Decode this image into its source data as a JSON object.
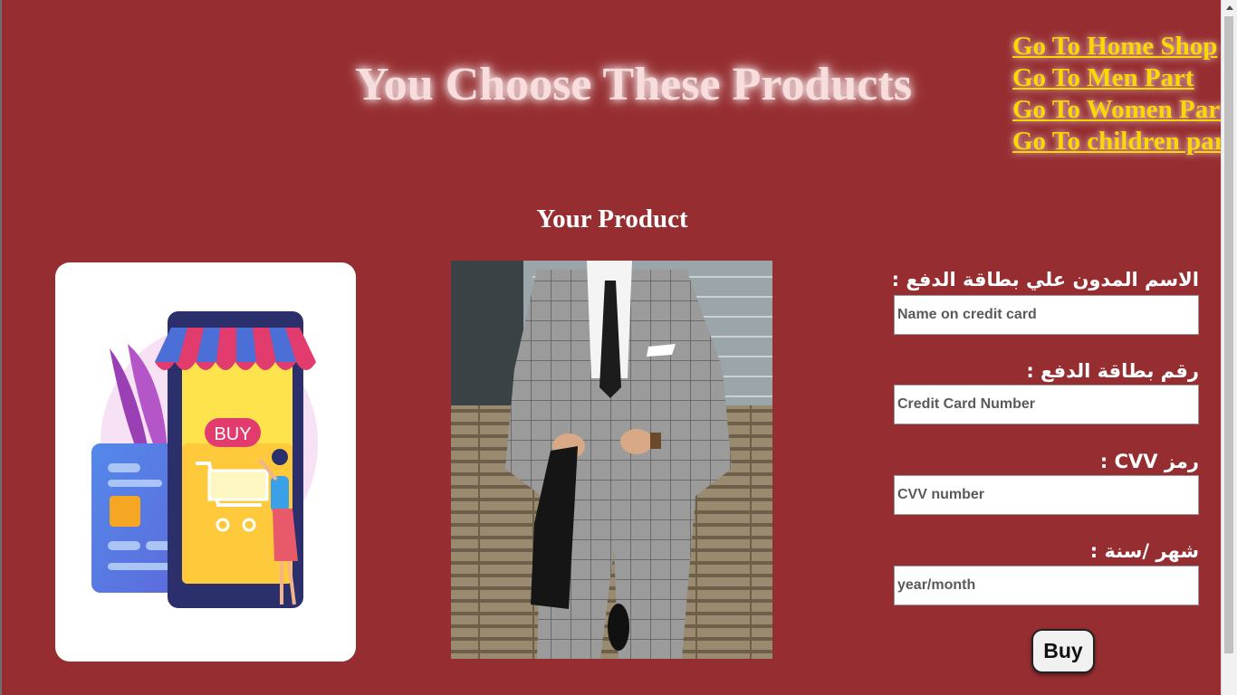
{
  "header": {
    "title": "You Choose These Products"
  },
  "nav": {
    "links": [
      {
        "label": "Go To Home Shop"
      },
      {
        "label": "Go To Men Part"
      },
      {
        "label": "Go To Women Part"
      },
      {
        "label": "Go To children part"
      }
    ]
  },
  "product": {
    "section_title": "Your Product"
  },
  "illustration": {
    "buy_text": "BUY"
  },
  "form": {
    "name_label": "الاسم المدون علي بطاقة الدفع :",
    "name_placeholder": "Name on credit card",
    "number_label": "رقم بطاقة الدفع :",
    "number_placeholder": "Credit Card Number",
    "cvv_label": "رمز CVV :",
    "cvv_placeholder": "CVV number",
    "expiry_label": "شهر /سنة :",
    "expiry_placeholder": "year/month",
    "buy_label": "Buy"
  },
  "colors": {
    "background": "#962e31",
    "link": "#ffd700",
    "title": "#f9dcdc"
  }
}
